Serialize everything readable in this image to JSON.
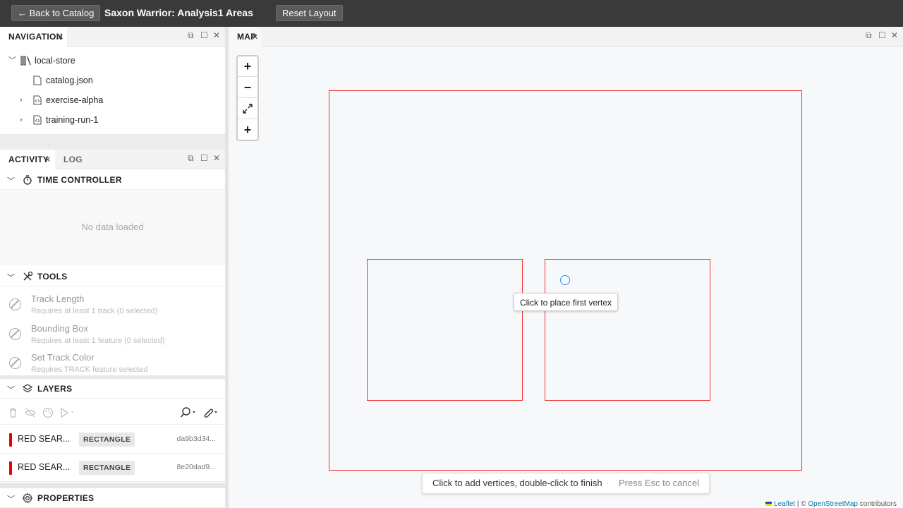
{
  "topbar": {
    "back_label": "← Back to Catalog",
    "title": "Saxon Warrior: Analysis1 Areas",
    "reset_label": "Reset Layout"
  },
  "navigation": {
    "tab": "NAVIGATION",
    "root": "local-store",
    "items": [
      "catalog.json",
      "exercise-alpha",
      "training-run-1"
    ]
  },
  "activity": {
    "tabs": [
      "ACTIVITY",
      "LOG"
    ],
    "time_controller": {
      "title": "TIME CONTROLLER",
      "empty": "No data loaded"
    },
    "tools": {
      "title": "TOOLS",
      "items": [
        {
          "name": "Track Length",
          "desc": "Requires at least 1 track (0 selected)"
        },
        {
          "name": "Bounding Box",
          "desc": "Requires at least 1 feature (0 selected)"
        },
        {
          "name": "Set Track Color",
          "desc": "Requires TRACK feature selected"
        }
      ]
    },
    "layers": {
      "title": "LAYERS",
      "rows": [
        {
          "name": "RED SEAR...",
          "type": "RECTANGLE",
          "id": "da9b3d34..."
        },
        {
          "name": "RED SEAR...",
          "type": "RECTANGLE",
          "id": "8e20dad9..."
        }
      ]
    },
    "properties": {
      "title": "PROPERTIES"
    }
  },
  "map": {
    "tab": "MAP",
    "zoom_in": "+",
    "zoom_out": "−",
    "draw": "+",
    "tooltip": "Click to place first vertex",
    "hint": "Click to add vertices, double-click to finish",
    "cancel": "Press Esc to cancel",
    "attribution_leaflet": "Leaflet",
    "attribution_sep": " | © ",
    "attribution_osm": "OpenStreetMap",
    "attribution_tail": " contributors"
  },
  "colors": {
    "rect": "#e33333",
    "layer_bar": "#ee0000",
    "topbar": "#3a3a3a"
  }
}
